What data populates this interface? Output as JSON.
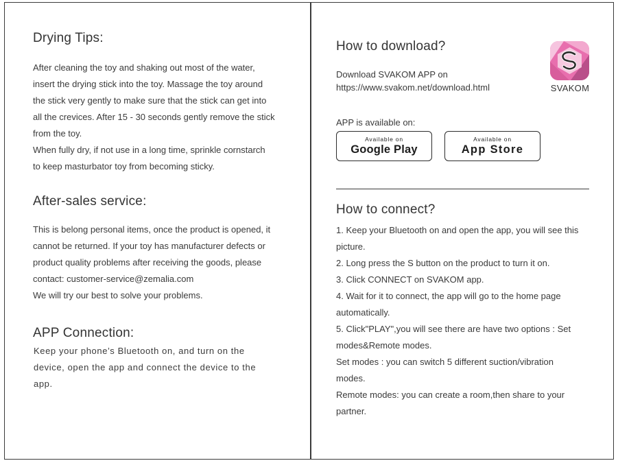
{
  "left": {
    "drying": {
      "title": "Drying Tips:",
      "lines": [
        "After cleaning the toy and shaking out most of the water,",
        "insert the drying stick into the toy. Massage the toy around",
        "the stick very gently to make sure that the stick can get into",
        "all the crevices. After 15 - 30 seconds gently remove the stick",
        "from the toy.",
        "When fully dry, if not use in a long time, sprinkle cornstarch",
        "to keep masturbator toy from becoming sticky."
      ]
    },
    "aftersales": {
      "title": "After-sales service:",
      "lines": [
        "This is belong personal items, once the product is opened, it",
        "cannot be returned. If your toy has manufacturer defects or",
        "product quality problems after receiving the goods, please",
        "contact: customer-service@zemalia.com",
        "We will try our best to solve your problems."
      ]
    },
    "app_connection": {
      "title": "APP Connection:",
      "lines": [
        "Keep your phone’s Bluetooth on, and turn on the",
        "device, open the app and connect the device to the",
        "app."
      ]
    }
  },
  "right": {
    "download": {
      "title": "How to download?",
      "line1": "Download SVAKOM APP on",
      "line2": "https://www.svakom.net/download.html",
      "brand": "SVAKOM",
      "available_label": "APP is available on:",
      "google": {
        "small": "Available on",
        "big": "Google Play"
      },
      "apple": {
        "small": "Available on",
        "big": "App Store"
      }
    },
    "connect": {
      "title": "How to connect?",
      "lines": [
        "1. Keep your Bluetooth on and open the app, you will see this",
        "picture.",
        "2. Long press the S button on the product to turn it on.",
        "3. Click CONNECT on SVAKOM app.",
        "4. Wait for it to connect, the app will go to the home page",
        "automatically.",
        "5. Click\"PLAY\",you will see there are have two options : Set",
        "modes&Remote modes.",
        "Set modes : you can switch 5 different suction/vibration",
        "modes.",
        "Remote modes: you can create a room,then share to your",
        "partner."
      ]
    }
  },
  "colors": {
    "border": "#3a3a3a",
    "logo_pink": "#e86fae",
    "logo_light": "#f6c4df",
    "logo_dark": "#b94f8a"
  }
}
